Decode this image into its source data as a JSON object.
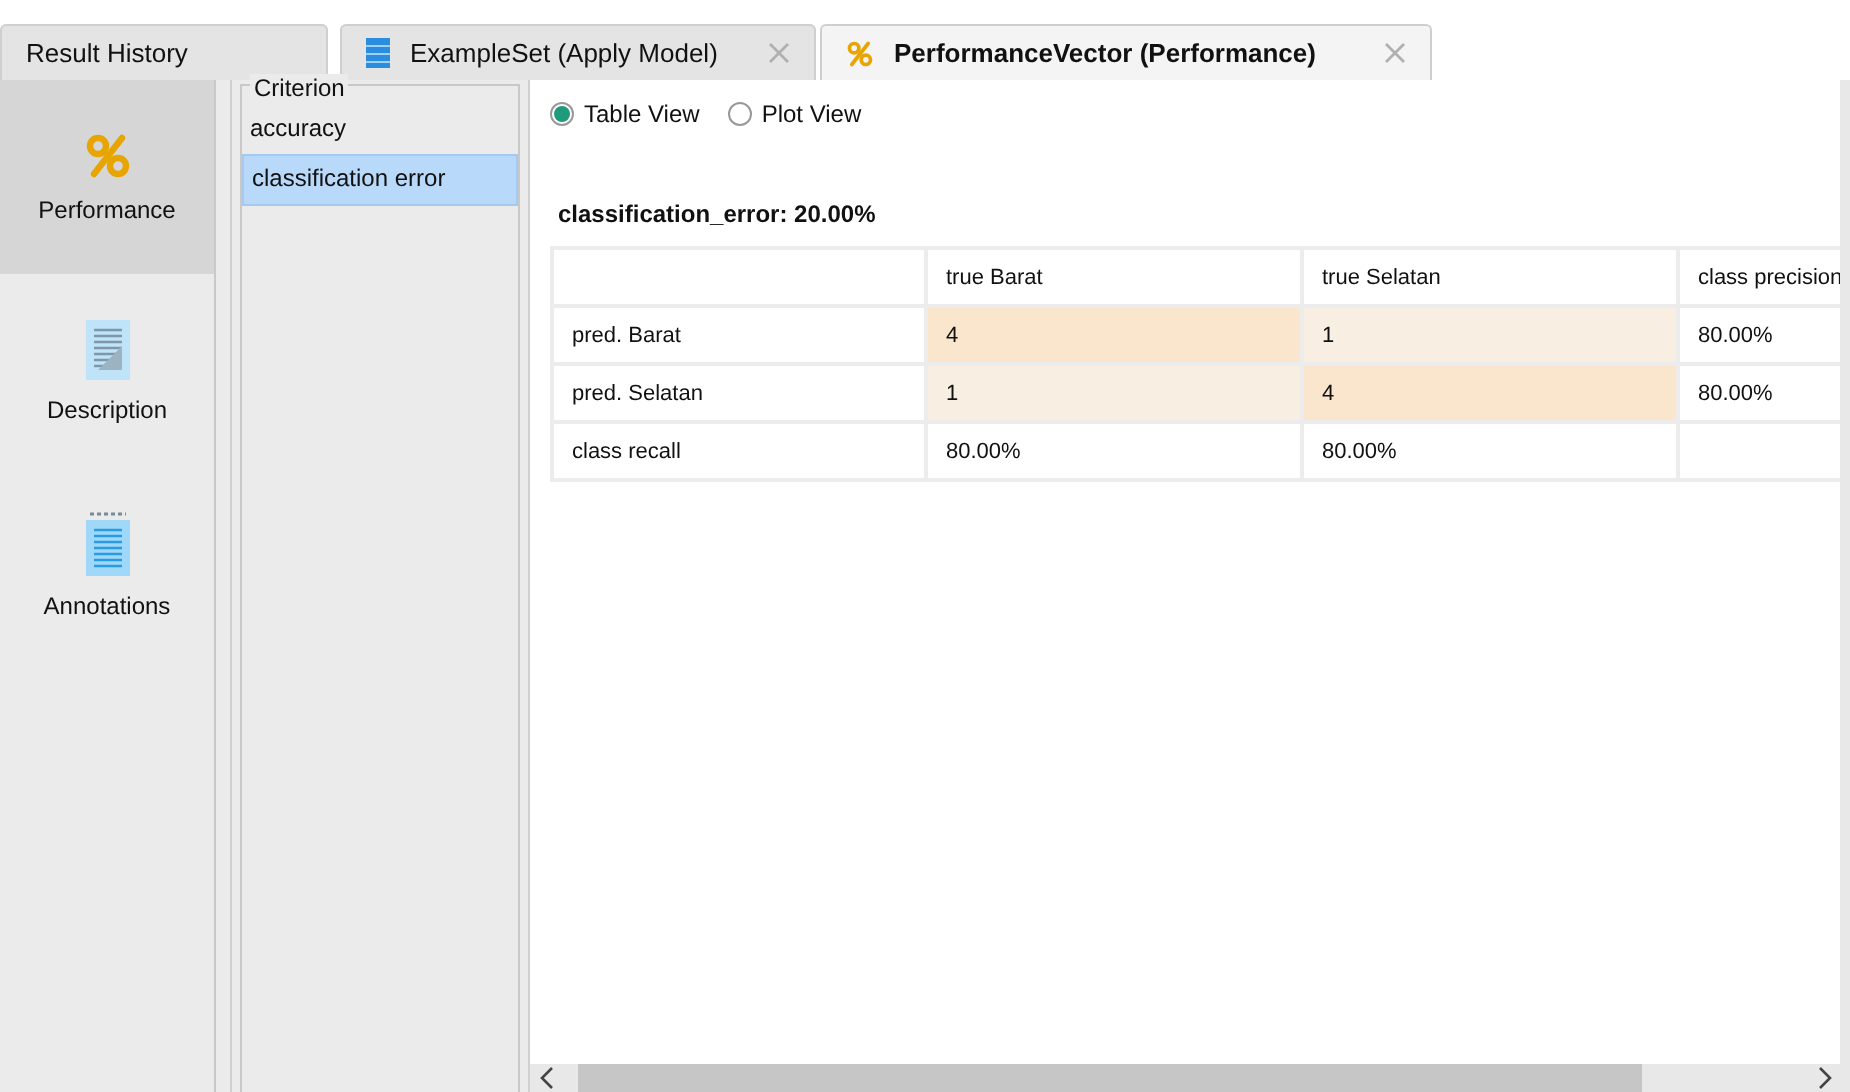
{
  "tabs": [
    {
      "label": "Result History",
      "selected": false
    },
    {
      "label": "ExampleSet (Apply Model)",
      "selected": false
    },
    {
      "label": "PerformanceVector (Performance)",
      "selected": true
    }
  ],
  "sidebar": {
    "items": [
      {
        "label": "Performance",
        "selected": true
      },
      {
        "label": "Description",
        "selected": false
      },
      {
        "label": "Annotations",
        "selected": false
      }
    ]
  },
  "criterion": {
    "title": "Criterion",
    "items": [
      {
        "label": "accuracy",
        "selected": false
      },
      {
        "label": "classification error",
        "selected": true
      }
    ]
  },
  "view_options": [
    {
      "label": "Table View",
      "selected": true
    },
    {
      "label": "Plot View",
      "selected": false
    }
  ],
  "result_title": "classification_error: 20.00%",
  "table": {
    "columns": [
      "true Barat",
      "true Selatan",
      "class precision"
    ],
    "rows": [
      {
        "label": "pred. Barat",
        "cells": [
          {
            "text": "4",
            "color": "#fae6cc"
          },
          {
            "text": "1",
            "color": "#f8efe2"
          },
          {
            "text": "80.00%"
          }
        ]
      },
      {
        "label": "pred. Selatan",
        "cells": [
          {
            "text": "1",
            "color": "#f8efe2"
          },
          {
            "text": "4",
            "color": "#fae6cc"
          },
          {
            "text": "80.00%"
          }
        ]
      },
      {
        "label": "class recall",
        "cells": [
          {
            "text": "80.00%"
          },
          {
            "text": "80.00%"
          }
        ]
      }
    ]
  }
}
